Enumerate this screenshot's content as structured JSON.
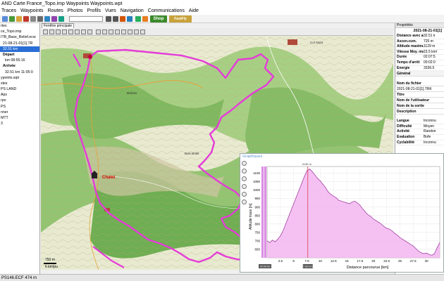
{
  "window": {
    "title": "AND Carte France_Topo.imp Waypoints Waypoints.wpt"
  },
  "menu": [
    "Traces",
    "Waypoints",
    "Routes",
    "Photos",
    "Profils",
    "Vues",
    "Navigation",
    "Communications",
    "Aide"
  ],
  "toolbar": {
    "shop_label": "Shop",
    "fastfly_label": "FastFly"
  },
  "tree": {
    "items": [
      {
        "label": "rtes",
        "indent": 0,
        "sel": false,
        "bold": false
      },
      {
        "label": "ce_Topo.imp",
        "indent": 0,
        "sel": false,
        "bold": false
      },
      {
        "label": "ITB_Base_Relief.ecw",
        "indent": 0,
        "sel": false,
        "bold": false
      },
      {
        "label": "21-08-21-01[1].TR",
        "indent": 1,
        "sel": false,
        "bold": false
      },
      {
        "label": "32.51 km",
        "indent": 1,
        "sel": true,
        "bold": false
      },
      {
        "label": "Départ",
        "indent": 1,
        "sel": false,
        "bold": true
      },
      {
        "label": "km  08:55:16",
        "indent": 2,
        "sel": false,
        "bold": false
      },
      {
        "label": "Arrivée",
        "indent": 1,
        "sel": false,
        "bold": true
      },
      {
        "label": "32.51 km  11:05:0",
        "indent": 2,
        "sel": false,
        "bold": false
      },
      {
        "label": "ypoints.wpt",
        "indent": 0,
        "sel": false,
        "bold": false
      },
      {
        "label": "xtes",
        "indent": 0,
        "sel": false,
        "bold": false
      },
      {
        "label": "PS LAND",
        "indent": 0,
        "sel": false,
        "bold": false
      },
      {
        "label": "Aps",
        "indent": 0,
        "sel": false,
        "bold": false
      },
      {
        "label": "rpo",
        "indent": 0,
        "sel": false,
        "bold": false
      },
      {
        "label": "PS",
        "indent": 0,
        "sel": false,
        "bold": false
      },
      {
        "label": "nner",
        "indent": 0,
        "sel": false,
        "bold": false
      },
      {
        "label": "MTT",
        "indent": 0,
        "sel": false,
        "bold": false
      },
      {
        "label": "3",
        "indent": 0,
        "sel": false,
        "bold": false
      }
    ]
  },
  "map": {
    "tab_label": "Fenêtre principale",
    "chalet_label": "Chalet",
    "scale_top": "750 m",
    "scale_bottom": "6 km/pu",
    "labels": [
      "Bois Brûlé",
      "Col Saint",
      "Brûnes"
    ]
  },
  "properties": {
    "header": "Propriétés",
    "date": "2021-08-21-01[1]",
    "rows": [
      {
        "key": "Distance avec altitu",
        "value": "32.51 k"
      },
      {
        "key": "Ascen.cum.",
        "value": "725 m"
      },
      {
        "key": "Altitude maximum",
        "value": "1129 m"
      },
      {
        "key": "Vitesse Moy. mvt",
        "value": "15.5 km/"
      },
      {
        "key": "Durée",
        "value": "02:07:5"
      },
      {
        "key": "Temps d'arrêt",
        "value": "00:02:0"
      },
      {
        "key": "Énergie",
        "value": "3336.5"
      }
    ],
    "section_general": "Général",
    "file_label": "Nom du fichier",
    "file_value": "2021-08-21-01[1].TRK",
    "fields": [
      "Titre",
      "Nom de l'utilisateur",
      "Nom de la sortie",
      "Description"
    ],
    "rows2": [
      {
        "key": "Langue",
        "value": "Inconnu"
      },
      {
        "key": "Difficulté",
        "value": "Moyen"
      },
      {
        "key": "Activité",
        "value": "Randon"
      },
      {
        "key": "Évaluation",
        "value": "Bofe"
      },
      {
        "key": "Cyclabilité",
        "value": "Inconnu"
      }
    ]
  },
  "graph": {
    "title": "Graphiques",
    "ylabel": "Altitude trace [m]",
    "xlabel": "Distance parcourue [km]",
    "cursor_x_label": "00:00:00",
    "cursor_label": "1130 m",
    "cursor_x_value": "7.66 km"
  },
  "chart_data": {
    "type": "area",
    "ylabel": "Altitude trace [m]",
    "xlabel": "Distance parcourue [km]",
    "ylim": [
      600,
      1140
    ],
    "xlim": [
      0,
      32.5
    ],
    "yticks": [
      650,
      700,
      750,
      800,
      850,
      900,
      950,
      1000,
      1050,
      1100
    ],
    "xticks": [
      2.5,
      5,
      7.5,
      10,
      12.5,
      15,
      17.5,
      20,
      22.5,
      25,
      27.5,
      30
    ],
    "cursor_x": 7.66,
    "series": [
      {
        "x": [
          0,
          0.5,
          1,
          1.5,
          2,
          2.5,
          3,
          3.5,
          4,
          4.5,
          5,
          5.5,
          6,
          6.5,
          7,
          7.5,
          8,
          8.5,
          9,
          9.5,
          10,
          10.5,
          11,
          11.5,
          12,
          12.5,
          13,
          13.5,
          14,
          14.5,
          15,
          15.5,
          16,
          16.5,
          17,
          17.5,
          18,
          18.5,
          19,
          19.5,
          20,
          20.5,
          21,
          21.5,
          22,
          22.5,
          23,
          23.5,
          24,
          24.5,
          25,
          25.5,
          26,
          26.5,
          27,
          27.5,
          28,
          28.5,
          29,
          29.5,
          30,
          30.5,
          31,
          31.5,
          32,
          32.5
        ],
        "values": [
          700,
          690,
          705,
          695,
          710,
          730,
          760,
          800,
          840,
          880,
          920,
          960,
          1000,
          1040,
          1080,
          1115,
          1125,
          1110,
          1090,
          1070,
          1055,
          1035,
          1015,
          990,
          975,
          965,
          955,
          940,
          935,
          930,
          925,
          920,
          930,
          935,
          925,
          910,
          890,
          870,
          855,
          845,
          830,
          820,
          810,
          800,
          785,
          775,
          770,
          760,
          745,
          735,
          720,
          710,
          700,
          690,
          680,
          670,
          655,
          640,
          630,
          625,
          628,
          620,
          615,
          625,
          660,
          690
        ]
      }
    ]
  },
  "status": {
    "text": "PS146.ECF  474 m"
  }
}
